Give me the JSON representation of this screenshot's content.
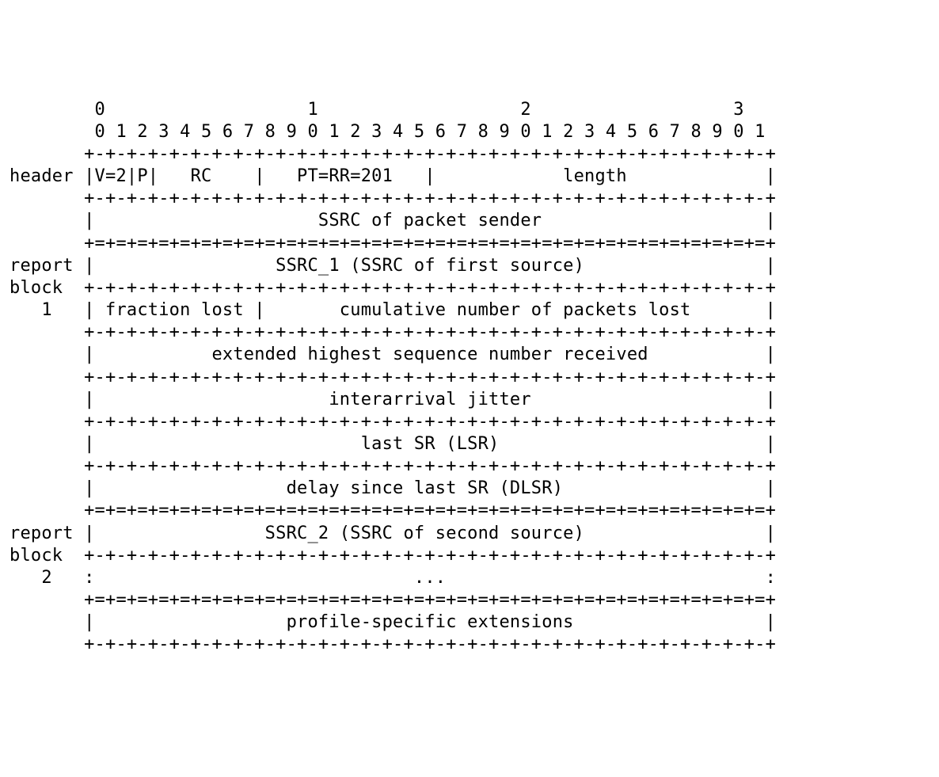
{
  "bitRuler": {
    "tens": "        0                   1                   2                   3",
    "units": "        0 1 2 3 4 5 6 7 8 9 0 1 2 3 4 5 6 7 8 9 0 1 2 3 4 5 6 7 8 9 0 1"
  },
  "labels": {
    "header": "header",
    "reportBlock1": {
      "l1": "report",
      "l2": "block",
      "l3": "1"
    },
    "reportBlock2": {
      "l1": "report",
      "l2": "block",
      "l3": "2"
    }
  },
  "fields": {
    "v": "V=2",
    "p": "P",
    "rc": "RC",
    "pt": "PT=RR=201",
    "length": "length",
    "ssrcSender": "SSRC of packet sender",
    "ssrc1": "SSRC_1 (SSRC of first source)",
    "fractionLost": "fraction lost",
    "cumLost": "cumulative number of packets lost",
    "extSeq": "extended highest sequence number received",
    "jitter": "interarrival jitter",
    "lsr": "last SR (LSR)",
    "dlsr": "delay since last SR (DLSR)",
    "ssrc2": "SSRC_2 (SSRC of second source)",
    "ellipsis": "...",
    "profileExt": "profile-specific extensions"
  },
  "borders": {
    "single": "       +-+-+-+-+-+-+-+-+-+-+-+-+-+-+-+-+-+-+-+-+-+-+-+-+-+-+-+-+-+-+-+-+",
    "double": "       +=+=+=+=+=+=+=+=+=+=+=+=+=+=+=+=+=+=+=+=+=+=+=+=+=+=+=+=+=+=+=+=+"
  },
  "diagram_structure": {
    "word_width_bits": 32,
    "sections": [
      {
        "name": "header",
        "rows": [
          {
            "fields": [
              {
                "name": "V",
                "bits": 2
              },
              {
                "name": "P",
                "bits": 1
              },
              {
                "name": "RC",
                "bits": 5
              },
              {
                "name": "PT",
                "bits": 8
              },
              {
                "name": "length",
                "bits": 16
              }
            ]
          },
          {
            "fields": [
              {
                "name": "SSRC of packet sender",
                "bits": 32
              }
            ]
          }
        ]
      },
      {
        "name": "report block 1",
        "rows": [
          {
            "fields": [
              {
                "name": "SSRC_1",
                "bits": 32
              }
            ]
          },
          {
            "fields": [
              {
                "name": "fraction lost",
                "bits": 8
              },
              {
                "name": "cumulative number of packets lost",
                "bits": 24
              }
            ]
          },
          {
            "fields": [
              {
                "name": "extended highest sequence number received",
                "bits": 32
              }
            ]
          },
          {
            "fields": [
              {
                "name": "interarrival jitter",
                "bits": 32
              }
            ]
          },
          {
            "fields": [
              {
                "name": "last SR (LSR)",
                "bits": 32
              }
            ]
          },
          {
            "fields": [
              {
                "name": "delay since last SR (DLSR)",
                "bits": 32
              }
            ]
          }
        ]
      },
      {
        "name": "report block 2",
        "rows": [
          {
            "fields": [
              {
                "name": "SSRC_2",
                "bits": 32
              }
            ]
          },
          {
            "continuation": true
          }
        ]
      },
      {
        "name": "extensions",
        "rows": [
          {
            "fields": [
              {
                "name": "profile-specific extensions",
                "bits": 32
              }
            ]
          }
        ]
      }
    ]
  }
}
